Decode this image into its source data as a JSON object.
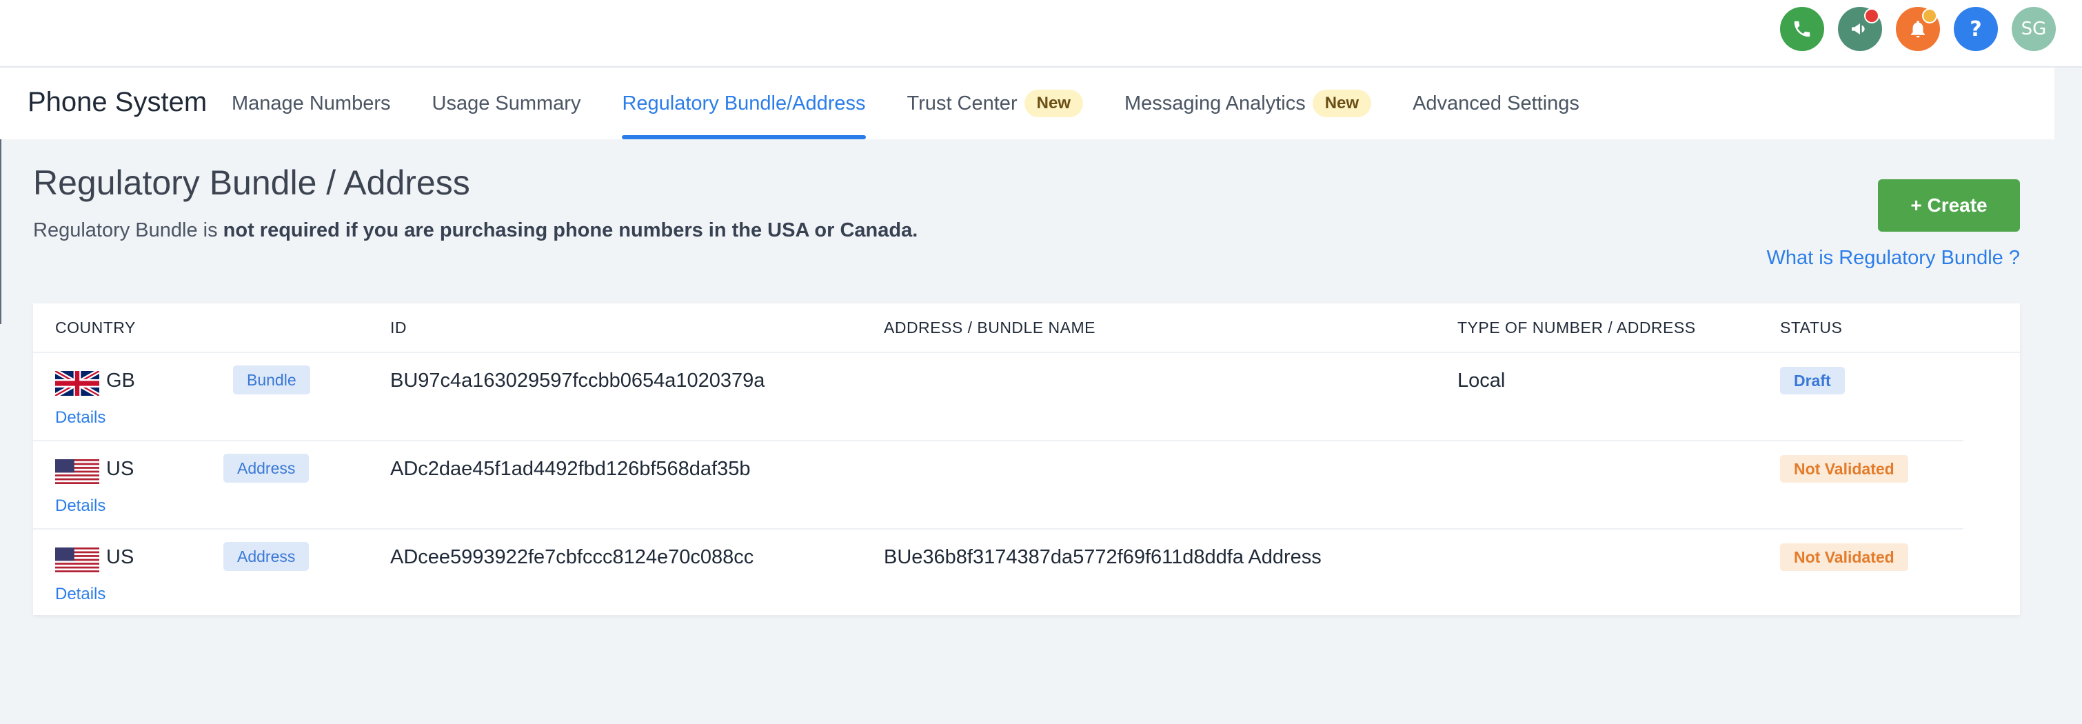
{
  "header": {
    "icons": [
      {
        "name": "phone-icon",
        "glyph": "✆",
        "color": "#3ea34c"
      },
      {
        "name": "megaphone-icon",
        "glyph": "📢",
        "color": "#4f8f75",
        "dot": "#e53935"
      },
      {
        "name": "bell-icon",
        "glyph": "🔔",
        "color": "#f07632",
        "dot": "#f3b43f"
      },
      {
        "name": "help-icon",
        "glyph": "?",
        "color": "#2f80ed"
      }
    ],
    "avatar_initials": "SG"
  },
  "nav": {
    "title": "Phone System",
    "tabs": [
      {
        "label": "Manage Numbers"
      },
      {
        "label": "Usage Summary"
      },
      {
        "label": "Regulatory Bundle/Address",
        "active": true
      },
      {
        "label": "Trust Center",
        "badge": "New"
      },
      {
        "label": "Messaging Analytics",
        "badge": "New"
      },
      {
        "label": "Advanced Settings"
      }
    ]
  },
  "page": {
    "heading": "Regulatory Bundle / Address",
    "subtitle_prefix": "Regulatory Bundle is ",
    "subtitle_bold": "not required if you are purchasing phone numbers in the USA or Canada.",
    "create_label": "+ Create",
    "help_link": "What is Regulatory Bundle ?"
  },
  "table": {
    "columns": {
      "country": "COUNTRY",
      "id": "ID",
      "name": "ADDRESS / BUNDLE NAME",
      "type": "TYPE OF NUMBER / ADDRESS",
      "status": "STATUS"
    },
    "rows": [
      {
        "flag": "uk",
        "country": "GB",
        "kind": "Bundle",
        "id": "BU97c4a163029597fccbb0654a1020379a",
        "name": "",
        "type": "Local",
        "status": "Draft",
        "details": "Details"
      },
      {
        "flag": "us",
        "country": "US",
        "kind": "Address",
        "id": "ADc2dae45f1ad4492fbd126bf568daf35b",
        "name": "",
        "type": "",
        "status": "Not Validated",
        "details": "Details"
      },
      {
        "flag": "us",
        "country": "US",
        "kind": "Address",
        "id": "ADcee5993922fe7cbfccc8124e70c088cc",
        "name": "BUe36b8f3174387da5772f69f611d8ddfa Address",
        "type": "",
        "status": "Not Validated",
        "details": "Details"
      }
    ]
  }
}
